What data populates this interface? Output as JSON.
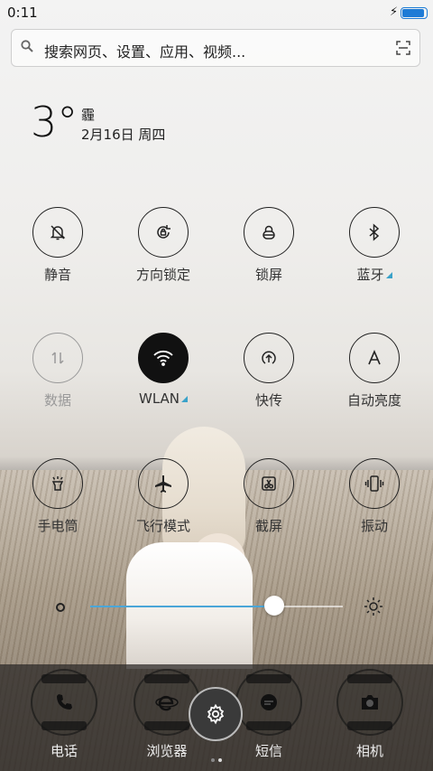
{
  "status_bar": {
    "time": "0:11",
    "battery_level": 1.0,
    "charging": true
  },
  "search": {
    "placeholder": "搜索网页、设置、应用、视频..."
  },
  "weather": {
    "temperature": "3°",
    "condition": "霾",
    "date": "2月16日 周四"
  },
  "toggles": [
    {
      "label": "静音",
      "icon": "mute-bell-icon",
      "state": "off"
    },
    {
      "label": "方向锁定",
      "icon": "rotation-lock-icon",
      "state": "off"
    },
    {
      "label": "锁屏",
      "icon": "lock-icon",
      "state": "off"
    },
    {
      "label": "蓝牙",
      "icon": "bluetooth-icon",
      "state": "off",
      "has_more": true
    },
    {
      "label": "数据",
      "icon": "mobile-data-icon",
      "state": "disabled"
    },
    {
      "label": "WLAN",
      "icon": "wifi-icon",
      "state": "on",
      "has_more": true
    },
    {
      "label": "快传",
      "icon": "quick-transfer-icon",
      "state": "off"
    },
    {
      "label": "自动亮度",
      "icon": "auto-brightness-icon",
      "state": "off"
    },
    {
      "label": "手电筒",
      "icon": "flashlight-icon",
      "state": "off"
    },
    {
      "label": "飞行模式",
      "icon": "airplane-icon",
      "state": "off"
    },
    {
      "label": "截屏",
      "icon": "screenshot-icon",
      "state": "off"
    },
    {
      "label": "振动",
      "icon": "vibrate-icon",
      "state": "off"
    }
  ],
  "brightness": {
    "level": 0.73
  },
  "dock": {
    "apps": [
      {
        "label": "电话",
        "icon": "phone-icon"
      },
      {
        "label": "浏览器",
        "icon": "browser-icon"
      },
      {
        "label": "短信",
        "icon": "message-icon"
      },
      {
        "label": "相机",
        "icon": "camera-icon"
      }
    ],
    "settings_icon": "gear-icon",
    "page_count": 2,
    "current_page": 2
  },
  "colors": {
    "accent": "#3aa2c9",
    "slider": "#4aa6d8",
    "battery": "#1e7bd6"
  }
}
